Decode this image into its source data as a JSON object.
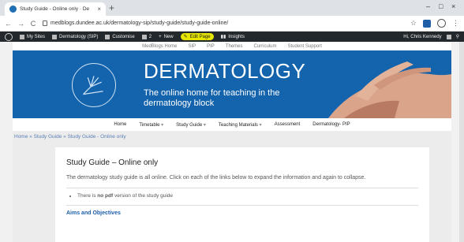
{
  "browser": {
    "tab_title": "Study Guide - Online only · De",
    "url": "medblogs.dundee.ac.uk/dermatology-sip/study-guide/study-guide-online/",
    "new_tab": "+",
    "close": "×",
    "back": "←",
    "forward": "→",
    "reload": "C",
    "star": "☆",
    "menu": "⋮",
    "minimize": "–",
    "maximize": "□",
    "close_window": "×"
  },
  "admin_bar": {
    "my_sites": "My Sites",
    "site_name": "Dermatology (SIP)",
    "customize": "Customise",
    "comments": "2",
    "new": "New",
    "edit_page": "Edit Page",
    "insights": "Insights",
    "user": "Hi, Chris Kennedy"
  },
  "top_nav": [
    "MedBlogs Home",
    "SIP",
    "PIP",
    "Themes",
    "Curriculum",
    "Student Support"
  ],
  "hero": {
    "title": "DERMATOLOGY",
    "tagline": "The online home for teaching in the dermatology block"
  },
  "main_nav": [
    {
      "label": "Home",
      "caret": ""
    },
    {
      "label": "Timetable",
      "caret": "▾"
    },
    {
      "label": "Study Guide",
      "caret": "▾"
    },
    {
      "label": "Teaching Materials",
      "caret": "▾"
    },
    {
      "label": "Assessment",
      "caret": ""
    },
    {
      "label": "Dermatology- PIP",
      "caret": ""
    }
  ],
  "breadcrumb": "Home » Study Guide » Study Guide - Online only",
  "content": {
    "heading": "Study Guide – Online only",
    "intro": "The dermatology study guide is all online. Click on each of the links below to expand the information and again to collapse.",
    "bullet_prefix": "There is ",
    "bullet_bold": "no pdf",
    "bullet_suffix": " version of the study guide",
    "section_link": "Aims and Objectives"
  },
  "colors": {
    "brand_blue": "#1463ad",
    "admin_bar": "#23282d",
    "highlight": "#e6e600"
  }
}
